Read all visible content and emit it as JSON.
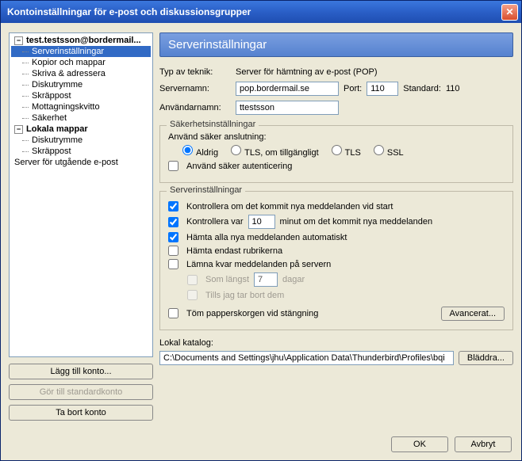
{
  "window": {
    "title": "Kontoinställningar för e-post och diskussionsgrupper"
  },
  "tree": {
    "account": "test.testsson@bordermail...",
    "items": [
      "Serverinställningar",
      "Kopior och mappar",
      "Skriva & adressera",
      "Diskutrymme",
      "Skräppost",
      "Mottagningskvitto",
      "Säkerhet"
    ],
    "local": "Lokala mappar",
    "localItems": [
      "Diskutrymme",
      "Skräppost"
    ],
    "outgoing": "Server för utgående e-post"
  },
  "sidebarButtons": {
    "add": "Lägg till konto...",
    "default": "Gör till standardkonto",
    "remove": "Ta bort konto"
  },
  "main": {
    "heading": "Serverinställningar",
    "typeLabel": "Typ av teknik:",
    "typeValue": "Server för hämtning av e-post (POP)",
    "serverLabel": "Servernamn:",
    "serverValue": "pop.bordermail.se",
    "portLabel": "Port:",
    "portValue": "110",
    "stdLabel": "Standard:",
    "stdValue": "110",
    "userLabel": "Användarnamn:",
    "userValue": "ttestsson"
  },
  "security": {
    "legend": "Säkerhetsinställningar",
    "useSecure": "Använd säker anslutning:",
    "never": "Aldrig",
    "tlsAvail": "TLS, om tillgängligt",
    "tls": "TLS",
    "ssl": "SSL",
    "secureAuth": "Använd säker autenticering"
  },
  "server": {
    "legend": "Serverinställningar",
    "checkStart": "Kontrollera om det kommit nya meddelanden vid start",
    "checkEveryA": "Kontrollera var",
    "checkEveryVal": "10",
    "checkEveryB": "minut om det kommit nya meddelanden",
    "fetchAll": "Hämta alla nya meddelanden automatiskt",
    "headersOnly": "Hämta endast rubrikerna",
    "leave": "Lämna kvar meddelanden på servern",
    "atMost": "Som längst",
    "atMostVal": "7",
    "days": "dagar",
    "untilDelete": "Tills jag tar bort dem",
    "emptyTrash": "Töm papperskorgen vid stängning",
    "advanced": "Avancerat..."
  },
  "local": {
    "label": "Lokal katalog:",
    "path": "C:\\Documents and Settings\\jhu\\Application Data\\Thunderbird\\Profiles\\bqi",
    "browse": "Bläddra..."
  },
  "footer": {
    "ok": "OK",
    "cancel": "Avbryt"
  }
}
